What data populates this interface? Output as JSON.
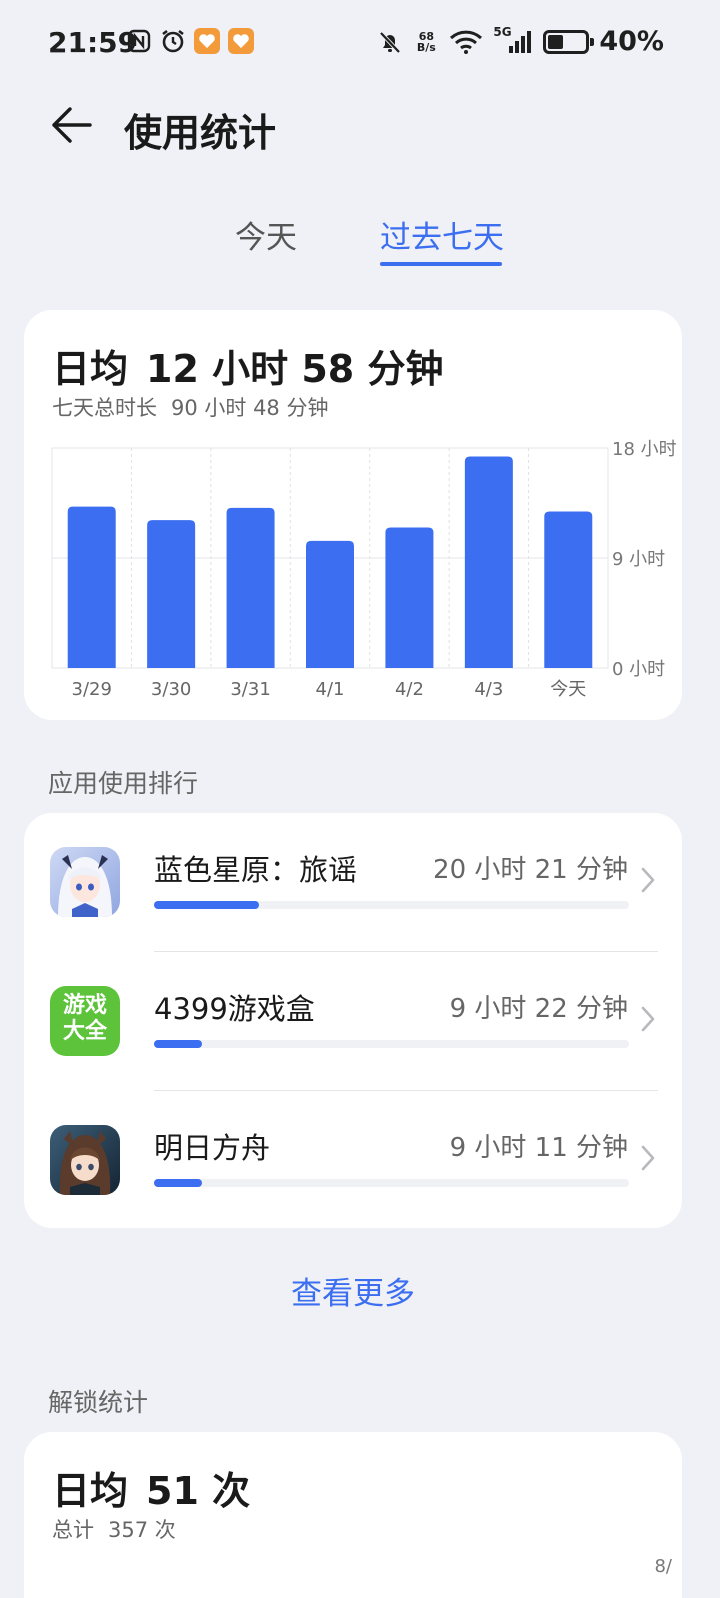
{
  "status_bar": {
    "time": "21:59",
    "net_speed_value": "68",
    "net_speed_unit": "B/s",
    "network_type": "5G",
    "battery_pct": "40%",
    "battery_level": 0.4
  },
  "header": {
    "title": "使用统计"
  },
  "tabs": [
    {
      "label": "今天",
      "active": false
    },
    {
      "label": "过去七天",
      "active": true
    }
  ],
  "usage": {
    "avg_label": "日均",
    "avg_value": "12 小时 58 分钟",
    "total_label": "七天总时长",
    "total_value": "90 小时 48 分钟"
  },
  "chart_data": {
    "type": "bar",
    "categories": [
      "3/29",
      "3/30",
      "3/31",
      "4/1",
      "4/2",
      "4/3",
      "今天"
    ],
    "values": [
      13.2,
      12.1,
      13.1,
      10.4,
      11.5,
      17.3,
      12.8
    ],
    "ylim": [
      0,
      18
    ],
    "yticks": [
      {
        "value": 18,
        "label": "18 小时"
      },
      {
        "value": 9,
        "label": "9 小时"
      },
      {
        "value": 0,
        "label": "0 小时"
      }
    ],
    "bar_color": "#3b6ef0",
    "grid": true,
    "axis_position": "right"
  },
  "ranking": {
    "section_title": "应用使用排行",
    "items": [
      {
        "name": "蓝色星原：旅谣",
        "time": "20 小时 21 分钟",
        "fraction": 0.22,
        "icon": "anime-girl-icon"
      },
      {
        "name": "4399游戏盒",
        "time": "9 小时 22 分钟",
        "fraction": 0.1,
        "icon": "game-box-icon",
        "icon_text_top": "游戏",
        "icon_text_bottom": "大全"
      },
      {
        "name": "明日方舟",
        "time": "9 小时 11 分钟",
        "fraction": 0.1,
        "icon": "arknights-icon"
      }
    ],
    "see_more": "查看更多"
  },
  "unlock": {
    "section_title": "解锁统计",
    "avg_label": "日均",
    "avg_value": "51 次",
    "total_label": "总计",
    "total_value": "357 次",
    "axis_label_top": "8/"
  },
  "colors": {
    "accent": "#3b6ef0",
    "background": "#f0f1f6",
    "card": "#ffffff"
  }
}
